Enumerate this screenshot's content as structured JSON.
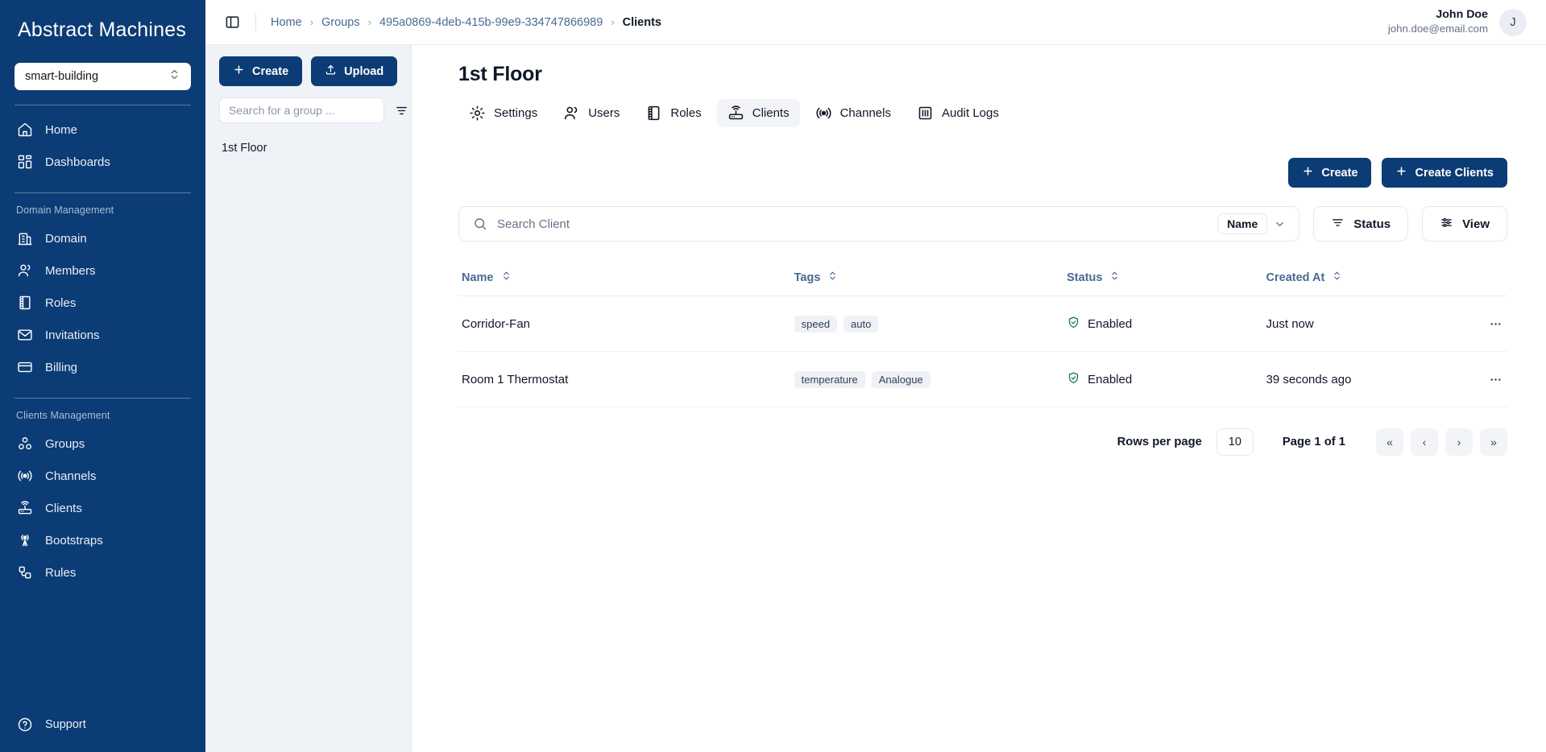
{
  "sidebar": {
    "brand": "Abstract Machines",
    "domain_selector": {
      "value": "smart-building"
    },
    "primary_items": [
      {
        "label": "Home",
        "icon": "home-icon"
      },
      {
        "label": "Dashboards",
        "icon": "dashboards-icon"
      }
    ],
    "sections": [
      {
        "title": "Domain Management",
        "items": [
          {
            "label": "Domain",
            "icon": "building-icon"
          },
          {
            "label": "Members",
            "icon": "users-icon"
          },
          {
            "label": "Roles",
            "icon": "book-icon"
          },
          {
            "label": "Invitations",
            "icon": "envelope-icon"
          },
          {
            "label": "Billing",
            "icon": "credit-card-icon"
          }
        ]
      },
      {
        "title": "Clients Management",
        "items": [
          {
            "label": "Groups",
            "icon": "groups-icon"
          },
          {
            "label": "Channels",
            "icon": "broadcast-icon"
          },
          {
            "label": "Clients",
            "icon": "router-icon"
          },
          {
            "label": "Bootstraps",
            "icon": "antenna-icon"
          },
          {
            "label": "Rules",
            "icon": "rules-icon"
          }
        ]
      }
    ],
    "support": {
      "label": "Support",
      "icon": "question-circle-icon"
    }
  },
  "topbar": {
    "panel_toggle_icon": "sidebar-toggle-icon",
    "breadcrumb": [
      {
        "label": "Home",
        "current": false
      },
      {
        "label": "Groups",
        "current": false
      },
      {
        "label": "495a0869-4deb-415b-99e9-334747866989",
        "current": false
      },
      {
        "label": "Clients",
        "current": true
      }
    ],
    "breadcrumb_separator": "›",
    "user": {
      "name": "John Doe",
      "email": "john.doe@email.com",
      "avatar_initial": "J"
    }
  },
  "groups_panel": {
    "create_button": "Create",
    "upload_button": "Upload",
    "search_placeholder": "Search for a group ...",
    "search_value": "",
    "filter_icon": "filter-icon",
    "tree": [
      {
        "label": "1st Floor"
      }
    ]
  },
  "main": {
    "title": "1st Floor",
    "tabs": [
      {
        "label": "Settings",
        "icon": "gear-icon",
        "active": false
      },
      {
        "label": "Users",
        "icon": "users-icon",
        "active": false
      },
      {
        "label": "Roles",
        "icon": "book-icon",
        "active": false
      },
      {
        "label": "Clients",
        "icon": "router-icon",
        "active": true
      },
      {
        "label": "Channels",
        "icon": "broadcast-icon",
        "active": false
      },
      {
        "label": "Audit Logs",
        "icon": "logs-icon",
        "active": false
      }
    ],
    "actions": {
      "create": "Create",
      "create_clients": "Create Clients"
    },
    "toolbar": {
      "search_placeholder": "Search Client",
      "search_value": "",
      "search_icon": "search-icon",
      "filter_field": "Name",
      "chevron_icon": "chevron-down-icon",
      "status_button": "Status",
      "status_icon": "sort-icon",
      "view_button": "View",
      "view_icon": "sliders-icon"
    },
    "table": {
      "columns": [
        {
          "label": "Name",
          "sortable": true
        },
        {
          "label": "Tags",
          "sortable": true
        },
        {
          "label": "Status",
          "sortable": true
        },
        {
          "label": "Created At",
          "sortable": true
        }
      ],
      "rows": [
        {
          "name": "Corridor-Fan",
          "tags": [
            "speed",
            "auto"
          ],
          "status": "Enabled",
          "status_icon": "shield-check-icon",
          "created_at": "Just now",
          "actions_icon": "more-horizontal-icon"
        },
        {
          "name": "Room 1 Thermostat",
          "tags": [
            "temperature",
            "Analogue"
          ],
          "status": "Enabled",
          "status_icon": "shield-check-icon",
          "created_at": "39 seconds ago",
          "actions_icon": "more-horizontal-icon"
        }
      ]
    },
    "pagination": {
      "rows_per_page_label": "Rows per page",
      "rows_per_page_value": "10",
      "page_info": "Page 1 of 1",
      "first_label": "«",
      "prev_label": "‹",
      "next_label": "›",
      "last_label": "»"
    }
  },
  "colors": {
    "brand_navy": "#0c3c75",
    "panel_bg": "#eff2f7",
    "accent_link": "#4a6a92",
    "status_enabled": "#107569",
    "text_primary": "#101828"
  }
}
